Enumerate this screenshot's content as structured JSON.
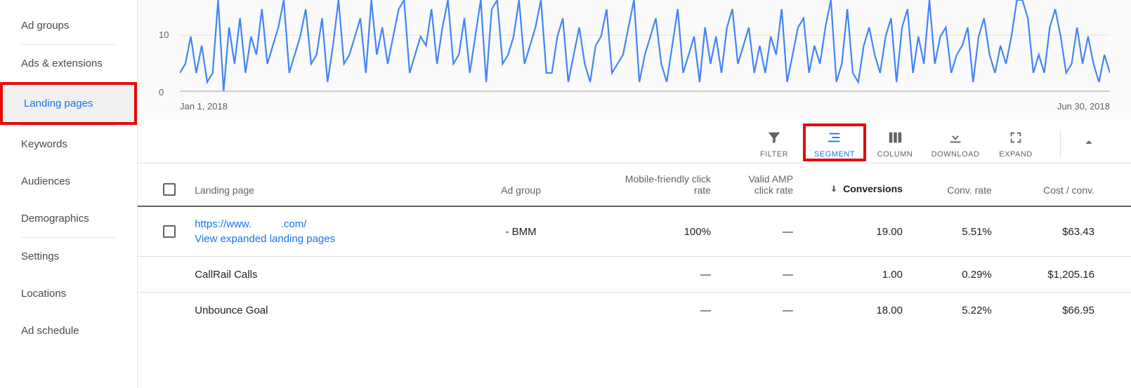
{
  "sidebar": {
    "items": [
      {
        "label": "Ad groups"
      },
      {
        "label": "Ads & extensions"
      },
      {
        "label": "Landing pages"
      },
      {
        "label": "Keywords"
      },
      {
        "label": "Audiences"
      },
      {
        "label": "Demographics"
      },
      {
        "label": "Settings"
      },
      {
        "label": "Locations"
      },
      {
        "label": "Ad schedule"
      }
    ]
  },
  "chart_data": {
    "type": "line",
    "title": "",
    "xlabel": "",
    "ylabel": "",
    "ylim": [
      0,
      20
    ],
    "grid": true,
    "y_ticks": [
      0,
      10
    ],
    "x_start_label": "Jan 1, 2018",
    "x_end_label": "Jun 30, 2018",
    "values": [
      4,
      6,
      12,
      4,
      10,
      2,
      4,
      20,
      0,
      14,
      6,
      16,
      4,
      12,
      8,
      18,
      6,
      10,
      14,
      20,
      4,
      8,
      12,
      18,
      6,
      8,
      16,
      2,
      10,
      20,
      6,
      8,
      12,
      16,
      4,
      20,
      8,
      14,
      6,
      12,
      18,
      20,
      4,
      8,
      12,
      10,
      18,
      6,
      14,
      20,
      6,
      8,
      16,
      4,
      12,
      20,
      2,
      18,
      20,
      6,
      8,
      12,
      20,
      6,
      10,
      14,
      20,
      4,
      4,
      12,
      16,
      2,
      8,
      14,
      6,
      2,
      10,
      12,
      18,
      4,
      6,
      8,
      14,
      20,
      2,
      8,
      12,
      16,
      6,
      2,
      10,
      18,
      4,
      8,
      12,
      2,
      14,
      6,
      12,
      4,
      14,
      18,
      6,
      10,
      14,
      4,
      10,
      4,
      12,
      8,
      18,
      2,
      8,
      14,
      16,
      4,
      10,
      6,
      14,
      20,
      2,
      6,
      18,
      4,
      2,
      10,
      14,
      8,
      4,
      12,
      16,
      2,
      14,
      18,
      4,
      12,
      6,
      20,
      6,
      12,
      14,
      4,
      8,
      10,
      14,
      2,
      12,
      16,
      8,
      4,
      10,
      6,
      12,
      20,
      20,
      16,
      4,
      8,
      4,
      14,
      18,
      12,
      4,
      6,
      14,
      6,
      12,
      6,
      2,
      8,
      4
    ]
  },
  "toolbar": {
    "filter": "FILTER",
    "segment": "SEGMENT",
    "column": "COLUMN",
    "download": "DOWNLOAD",
    "expand": "EXPAND"
  },
  "table": {
    "headers": {
      "landing_page": "Landing page",
      "ad_group": "Ad group",
      "mobile_rate": "Mobile-friendly click rate",
      "amp_rate": "Valid AMP click rate",
      "conversions": "Conversions",
      "conv_rate": "Conv. rate",
      "cost_conv": "Cost / conv."
    },
    "rows": [
      {
        "url_prefix": "https://www.",
        "url_suffix": ".com/",
        "sub_link": "View expanded landing pages",
        "ad_group": "- BMM",
        "mobile_rate": "100%",
        "amp_rate": "—",
        "conversions": "19.00",
        "conv_rate": "5.51%",
        "cost_conv": "$63.43"
      },
      {
        "label": "CallRail Calls",
        "mobile_rate": "—",
        "amp_rate": "—",
        "conversions": "1.00",
        "conv_rate": "0.29%",
        "cost_conv": "$1,205.16"
      },
      {
        "label": "Unbounce Goal",
        "mobile_rate": "—",
        "amp_rate": "—",
        "conversions": "18.00",
        "conv_rate": "5.22%",
        "cost_conv": "$66.95"
      }
    ]
  }
}
